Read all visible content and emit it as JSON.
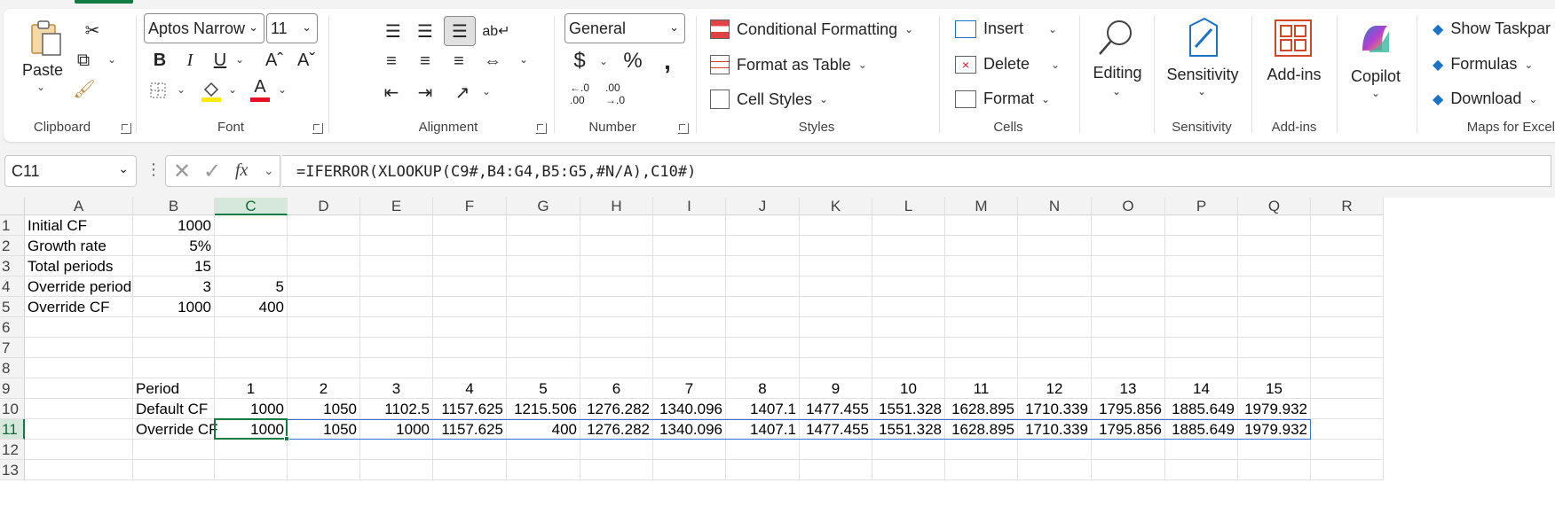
{
  "ribbon": {
    "clipboard": {
      "paste": "Paste",
      "label": "Clipboard"
    },
    "font": {
      "name": "Aptos Narrow",
      "size": "11",
      "label": "Font"
    },
    "alignment": {
      "label": "Alignment"
    },
    "number": {
      "format": "General",
      "label": "Number"
    },
    "styles": {
      "conditional": "Conditional Formatting",
      "table": "Format as Table",
      "cellstyles": "Cell Styles",
      "label": "Styles"
    },
    "cells": {
      "insert": "Insert",
      "delete": "Delete",
      "format": "Format",
      "label": "Cells"
    },
    "editing": {
      "label": "Editing"
    },
    "sensitivity": {
      "button": "Sensitivity",
      "label": "Sensitivity"
    },
    "addins": {
      "button": "Add-ins",
      "label": "Add-ins"
    },
    "copilot": {
      "button": "Copilot"
    },
    "maps": {
      "taskpane": "Show Taskpar",
      "formulas": "Formulas",
      "download": "Download",
      "label": "Maps for Excel"
    }
  },
  "formula_bar": {
    "name_box": "C11",
    "fx": "fx",
    "formula": "=IFERROR(XLOOKUP(C9#,B4:G4,B5:G5,#N/A),C10#)"
  },
  "grid": {
    "columns": [
      "A",
      "B",
      "C",
      "D",
      "E",
      "F",
      "G",
      "H",
      "I",
      "J",
      "K",
      "L",
      "M",
      "N",
      "O",
      "P",
      "Q",
      "R"
    ],
    "rows": [
      "1",
      "2",
      "3",
      "4",
      "5",
      "6",
      "7",
      "8",
      "9",
      "10",
      "11",
      "12",
      "13"
    ],
    "selected_column": "C",
    "selected_row": "11",
    "cells": {
      "A1": "Initial CF",
      "B1": "1000",
      "A2": "Growth rate",
      "B2": "5%",
      "A3": "Total periods",
      "B3": "15",
      "A4": "Override period",
      "B4": "3",
      "C4": "5",
      "A5": "Override CF",
      "B5": "1000",
      "C5": "400",
      "B9": "Period",
      "C9": "1",
      "D9": "2",
      "E9": "3",
      "F9": "4",
      "G9": "5",
      "H9": "6",
      "I9": "7",
      "J9": "8",
      "K9": "9",
      "L9": "10",
      "M9": "11",
      "N9": "12",
      "O9": "13",
      "P9": "14",
      "Q9": "15",
      "B10": "Default CF",
      "C10": "1000",
      "D10": "1050",
      "E10": "1102.5",
      "F10": "1157.625",
      "G10": "1215.506",
      "H10": "1276.282",
      "I10": "1340.096",
      "J10": "1407.1",
      "K10": "1477.455",
      "L10": "1551.328",
      "M10": "1628.895",
      "N10": "1710.339",
      "O10": "1795.856",
      "P10": "1885.649",
      "Q10": "1979.932",
      "B11": "Override CF",
      "C11": "1000",
      "D11": "1050",
      "E11": "1000",
      "F11": "1157.625",
      "G11": "400",
      "H11": "1276.282",
      "I11": "1340.096",
      "J11": "1407.1",
      "K11": "1477.455",
      "L11": "1551.328",
      "M11": "1628.895",
      "N11": "1710.339",
      "O11": "1795.856",
      "P11": "1885.649",
      "Q11": "1979.932"
    }
  },
  "colors": {
    "accent": "#107c41",
    "selection": "#3a6ed8"
  }
}
